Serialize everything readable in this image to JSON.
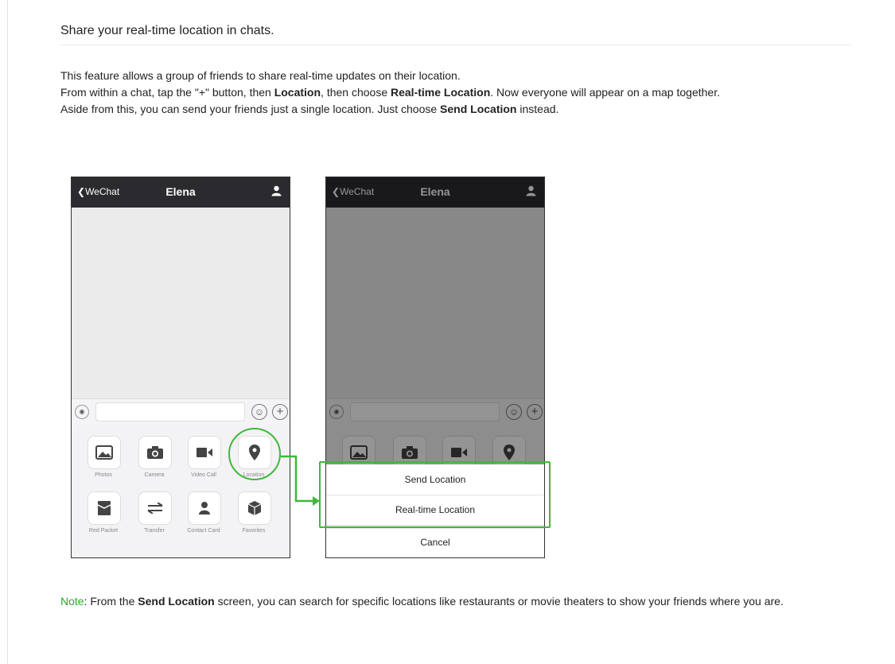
{
  "heading": "Share your real-time location in chats.",
  "intro": {
    "line1": "This feature allows a group of friends to share real-time updates on their location.",
    "line2_a": "From within a chat, tap the \"+\" button, then ",
    "line2_b": "Location",
    "line2_c": ", then choose ",
    "line2_d": "Real-time Location",
    "line2_e": ". Now everyone will appear on a map together.",
    "line3_a": "Aside from this, you can send your friends just a single location. Just choose ",
    "line3_b": "Send Location",
    "line3_c": " instead."
  },
  "phone1": {
    "back_label": "WeChat",
    "title": "Elena",
    "panel_items": [
      {
        "label": "Photos",
        "icon": "photo-icon"
      },
      {
        "label": "Camera",
        "icon": "camera-icon"
      },
      {
        "label": "Video Call",
        "icon": "video-icon"
      },
      {
        "label": "Location",
        "icon": "location-pin-icon"
      },
      {
        "label": "Red Packet",
        "icon": "red-packet-icon"
      },
      {
        "label": "Transfer",
        "icon": "transfer-icon"
      },
      {
        "label": "Contact Card",
        "icon": "contact-icon"
      },
      {
        "label": "Favorites",
        "icon": "favorites-icon"
      }
    ]
  },
  "phone2": {
    "back_label": "WeChat",
    "title": "Elena",
    "sheet": {
      "send_location": "Send Location",
      "realtime_location": "Real-time Location",
      "cancel": "Cancel"
    }
  },
  "note": {
    "label": "Note",
    "text_a": ": From the ",
    "text_b": "Send Location",
    "text_c": " screen, you can search for specific locations like restaurants or movie theaters to show your friends where you are."
  },
  "colors": {
    "highlight": "#3fb83a",
    "nav": "#2b2b2f",
    "note_label": "#2aa82a"
  }
}
